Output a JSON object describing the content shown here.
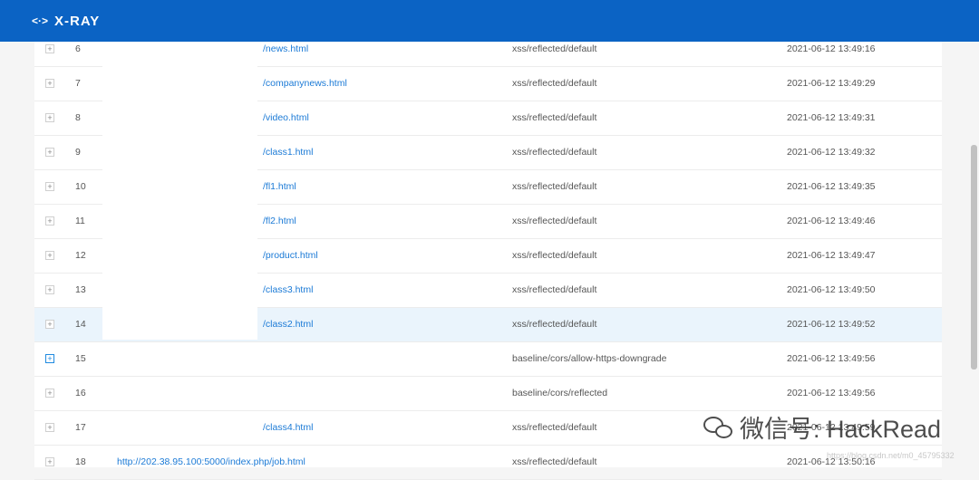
{
  "app": {
    "logo_text": "X-RAY",
    "logo_icon": "<·>"
  },
  "rows": [
    {
      "num": "6",
      "url": "/news.html",
      "plugin": "xss/reflected/default",
      "time": "2021-06-12 13:49:16"
    },
    {
      "num": "7",
      "url": "/companynews.html",
      "plugin": "xss/reflected/default",
      "time": "2021-06-12 13:49:29"
    },
    {
      "num": "8",
      "url": "/video.html",
      "plugin": "xss/reflected/default",
      "time": "2021-06-12 13:49:31"
    },
    {
      "num": "9",
      "url": "/class1.html",
      "plugin": "xss/reflected/default",
      "time": "2021-06-12 13:49:32"
    },
    {
      "num": "10",
      "url": "/fl1.html",
      "plugin": "xss/reflected/default",
      "time": "2021-06-12 13:49:35"
    },
    {
      "num": "11",
      "url": "/fl2.html",
      "plugin": "xss/reflected/default",
      "time": "2021-06-12 13:49:46"
    },
    {
      "num": "12",
      "url": "/product.html",
      "plugin": "xss/reflected/default",
      "time": "2021-06-12 13:49:47"
    },
    {
      "num": "13",
      "url": "/class3.html",
      "plugin": "xss/reflected/default",
      "time": "2021-06-12 13:49:50"
    },
    {
      "num": "14",
      "url": "/class2.html",
      "plugin": "xss/reflected/default",
      "time": "2021-06-12 13:49:52"
    },
    {
      "num": "15",
      "url": "",
      "plugin": "baseline/cors/allow-https-downgrade",
      "time": "2021-06-12 13:49:56"
    },
    {
      "num": "16",
      "url": "",
      "plugin": "baseline/cors/reflected",
      "time": "2021-06-12 13:49:56"
    },
    {
      "num": "17",
      "url": "/class4.html",
      "plugin": "xss/reflected/default",
      "time": "2021-06-12 13:49:59"
    },
    {
      "num": "18",
      "url": "http://202.38.95.100:5000/index.php/job.html",
      "plugin": "xss/reflected/default",
      "time": "2021-06-12 13:50:16"
    }
  ],
  "highlight_row": "14",
  "active_expand_row": "15",
  "expand_symbol": "+",
  "watermark": {
    "text": "微信号: HackRead",
    "sub": "https://blog.csdn.net/m0_45795332"
  }
}
